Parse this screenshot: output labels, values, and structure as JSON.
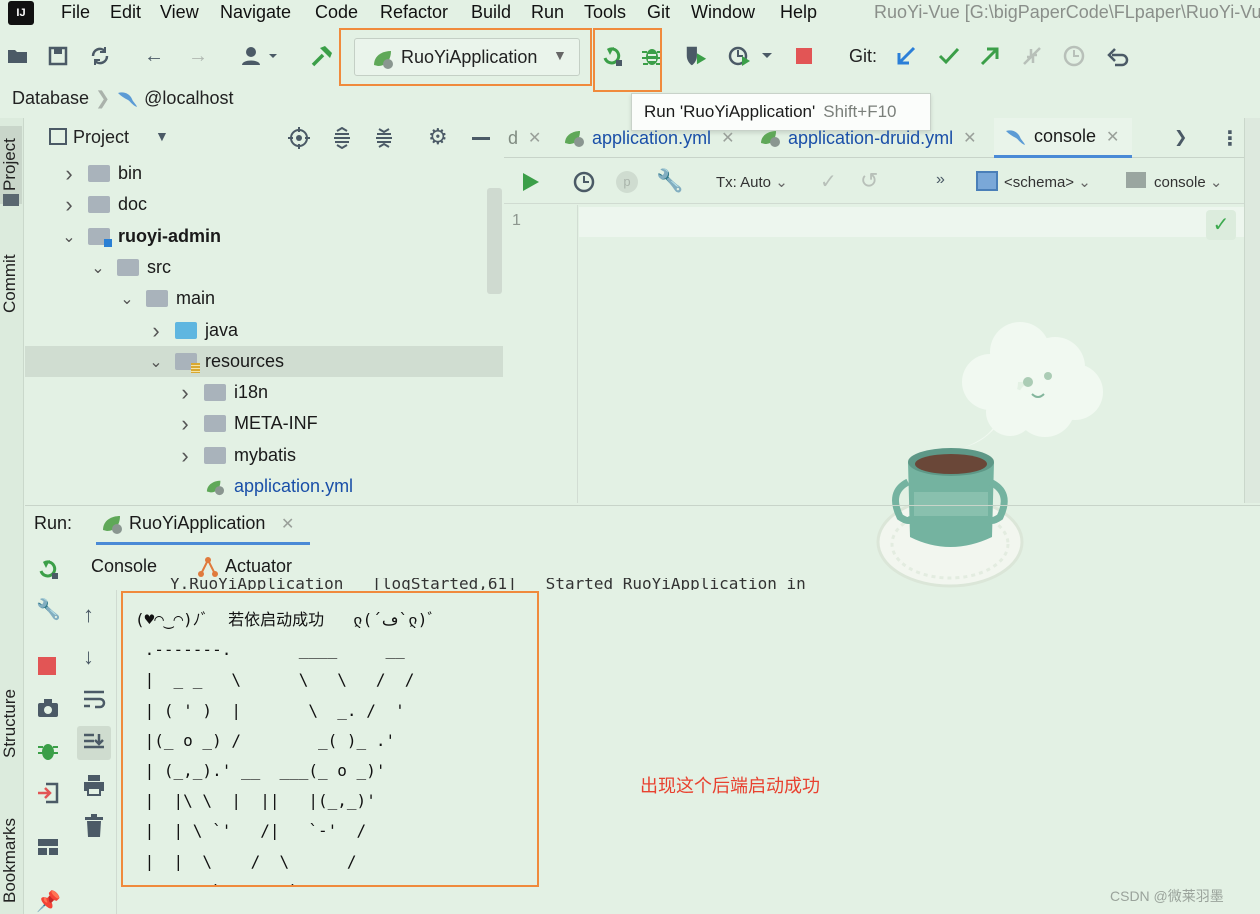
{
  "menu": {
    "items": [
      "File",
      "Edit",
      "View",
      "Navigate",
      "Code",
      "Refactor",
      "Build",
      "Run",
      "Tools",
      "Git",
      "Window",
      "Help"
    ],
    "window_title": "RuoYi-Vue [G:\\bigPaperCode\\FLpaper\\RuoYi-Vu"
  },
  "toolbar": {
    "run_config": "RuoYiApplication",
    "git_label": "Git:"
  },
  "tooltip": {
    "text": "Run 'RuoYiApplication'",
    "shortcut": "Shift+F10"
  },
  "breadcrumb": {
    "root": "Database",
    "host": "@localhost"
  },
  "left_stripe": {
    "project": "Project",
    "commit": "Commit",
    "structure": "Structure",
    "bookmarks": "Bookmarks"
  },
  "project": {
    "title": "Project",
    "tree": [
      {
        "label": "bin",
        "depth": 0,
        "expanded": false,
        "icon": "folder-icon"
      },
      {
        "label": "doc",
        "depth": 0,
        "expanded": false,
        "icon": "folder-icon"
      },
      {
        "label": "ruoyi-admin",
        "depth": 0,
        "expanded": true,
        "icon": "module-folder-icon",
        "bold": true
      },
      {
        "label": "src",
        "depth": 1,
        "expanded": true,
        "icon": "folder-icon"
      },
      {
        "label": "main",
        "depth": 2,
        "expanded": true,
        "icon": "folder-icon"
      },
      {
        "label": "java",
        "depth": 3,
        "expanded": false,
        "icon": "source-folder-icon"
      },
      {
        "label": "resources",
        "depth": 3,
        "expanded": true,
        "icon": "resources-folder-icon",
        "selected": true
      },
      {
        "label": "i18n",
        "depth": 4,
        "expanded": false,
        "icon": "folder-icon"
      },
      {
        "label": "META-INF",
        "depth": 4,
        "expanded": false,
        "icon": "folder-icon"
      },
      {
        "label": "mybatis",
        "depth": 4,
        "expanded": false,
        "icon": "folder-icon"
      },
      {
        "label": "application.yml",
        "depth": 4,
        "leaf": true,
        "icon": "spring-yml-icon"
      }
    ]
  },
  "editor": {
    "tabs": [
      {
        "label": "d",
        "partial": true
      },
      {
        "label": "application.yml"
      },
      {
        "label": "application-druid.yml"
      },
      {
        "label": "console",
        "active": true
      }
    ],
    "tx_mode": "Tx: Auto",
    "schema": "<schema>",
    "console_target": "console",
    "line_number": "1"
  },
  "run": {
    "label": "Run:",
    "tab": "RuoYiApplication",
    "console_tab": "Console",
    "actuator_tab": "Actuator",
    "clipped_log": "Y.RuoYiApplication   [logStarted,61]   Started RuoYiApplication in",
    "banner": "(♥◠‿◠)ﾉﾞ  若依启动成功   ლ(´ڡ`ლ)ﾞ\n .-------.       ____     __\n |  _ _   \\      \\   \\   /  /\n | ( ' )  |       \\  _. /  '\n |(_ o _) /        _( )_ .'\n | (_,_).' __  ___(_ o _)'\n |  |\\ \\  |  ||   |(_,_)'\n |  | \\ `'   /|   `-'  /\n |  |  \\    /  \\      /\n ''-'   `'-'    `-..-'"
  },
  "annotation": "出现这个后端启动成功",
  "watermark": "CSDN @微莱羽墨",
  "colors": {
    "background": "#e3f1e4",
    "highlight": "#f08a3c",
    "run_green": "#3daa4f",
    "stop_red": "#e25555",
    "link_blue": "#1a4fa8",
    "annotation_red": "#e8412f"
  }
}
